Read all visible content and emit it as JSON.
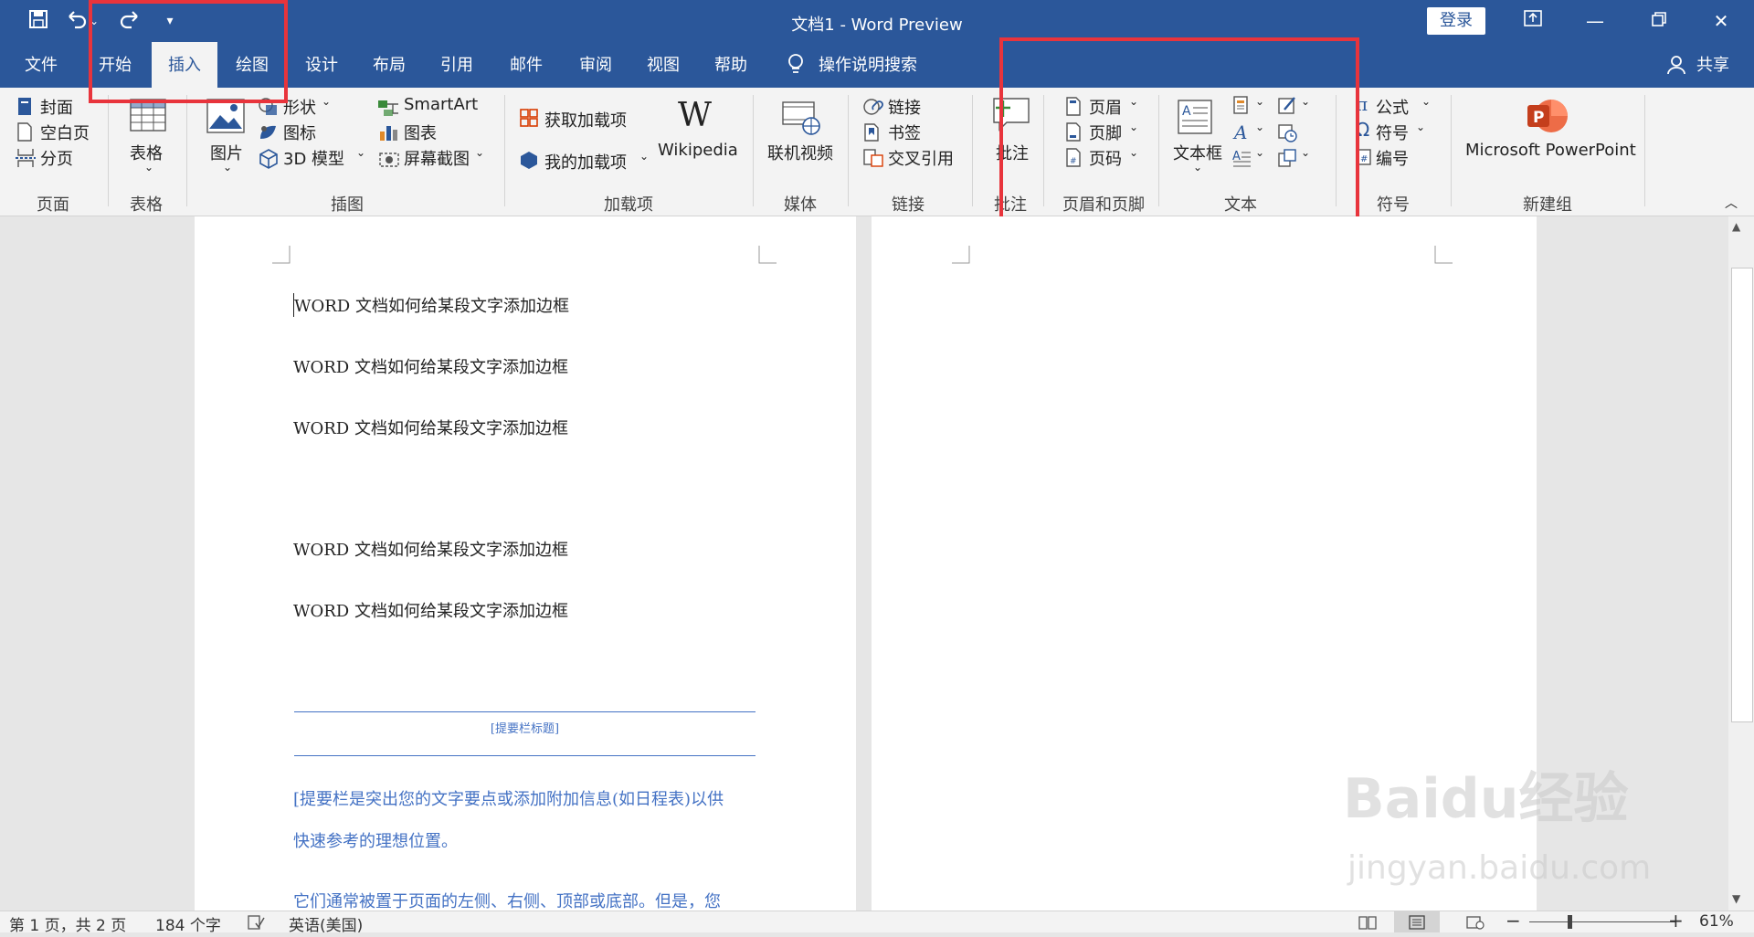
{
  "window": {
    "title": "文档1  -  Word Preview",
    "login_label": "登录",
    "share_label": "共享",
    "colors": {
      "titlebar": "#2b579a",
      "annotation": "#e8343c",
      "sidebar_text": "#4472c4"
    }
  },
  "quick_access": [
    "save-icon",
    "undo-icon",
    "redo-icon",
    "customize-icon"
  ],
  "tabs": [
    "文件",
    "开始",
    "插入",
    "绘图",
    "设计",
    "布局",
    "引用",
    "邮件",
    "审阅",
    "视图",
    "帮助"
  ],
  "tell_me": "操作说明搜索",
  "ribbon": {
    "pages": {
      "items": [
        "封面",
        "空白页",
        "分页"
      ],
      "label": "页面"
    },
    "tables": {
      "item": "表格",
      "label": "表格"
    },
    "illustrations": {
      "picture": "图片",
      "shapes": "形状",
      "icons": "图标",
      "model3d": "3D 模型",
      "smartart": "SmartArt",
      "chart": "图表",
      "screenshot": "屏幕截图",
      "label": "插图"
    },
    "addins": {
      "get": "获取加载项",
      "my": "我的加载项",
      "wikipedia": "Wikipedia",
      "label": "加载项"
    },
    "media": {
      "video": "联机视频",
      "label": "媒体"
    },
    "links": {
      "link": "链接",
      "bookmark": "书签",
      "crossref": "交叉引用",
      "label": "链接"
    },
    "comments": {
      "comment": "批注",
      "label": "批注"
    },
    "header_footer": {
      "header": "页眉",
      "footer": "页脚",
      "page_number": "页码",
      "label": "页眉和页脚"
    },
    "text": {
      "textbox": "文本框",
      "label": "文本"
    },
    "symbols": {
      "equation": "公式",
      "symbol": "符号",
      "numbering": "编号",
      "label": "符号"
    },
    "new_group": {
      "powerpoint": "Microsoft PowerPoint",
      "label": "新建组"
    }
  },
  "document": {
    "paragraphs": [
      "WORD 文档如何给某段文字添加边框",
      "WORD 文档如何给某段文字添加边框",
      "WORD 文档如何给某段文字添加边框",
      "WORD 文档如何给某段文字添加边框",
      "WORD 文档如何给某段文字添加边框"
    ],
    "sidebar_title": "[提要栏标题]",
    "sidebar_line1": "[提要栏是突出您的文字要点或添加附加信息(如日程表)以供",
    "sidebar_line2": "快速参考的理想位置。",
    "sidebar_line3": "它们通常被置于页面的左侧、右侧、顶部或底部。但是，您"
  },
  "status": {
    "page": "第 1 页，共 2 页",
    "words": "184 个字",
    "language": "英语(美国)",
    "zoom": "61%"
  },
  "watermark": {
    "brand": "Baidu经验",
    "url": "jingyan.baidu.com"
  }
}
